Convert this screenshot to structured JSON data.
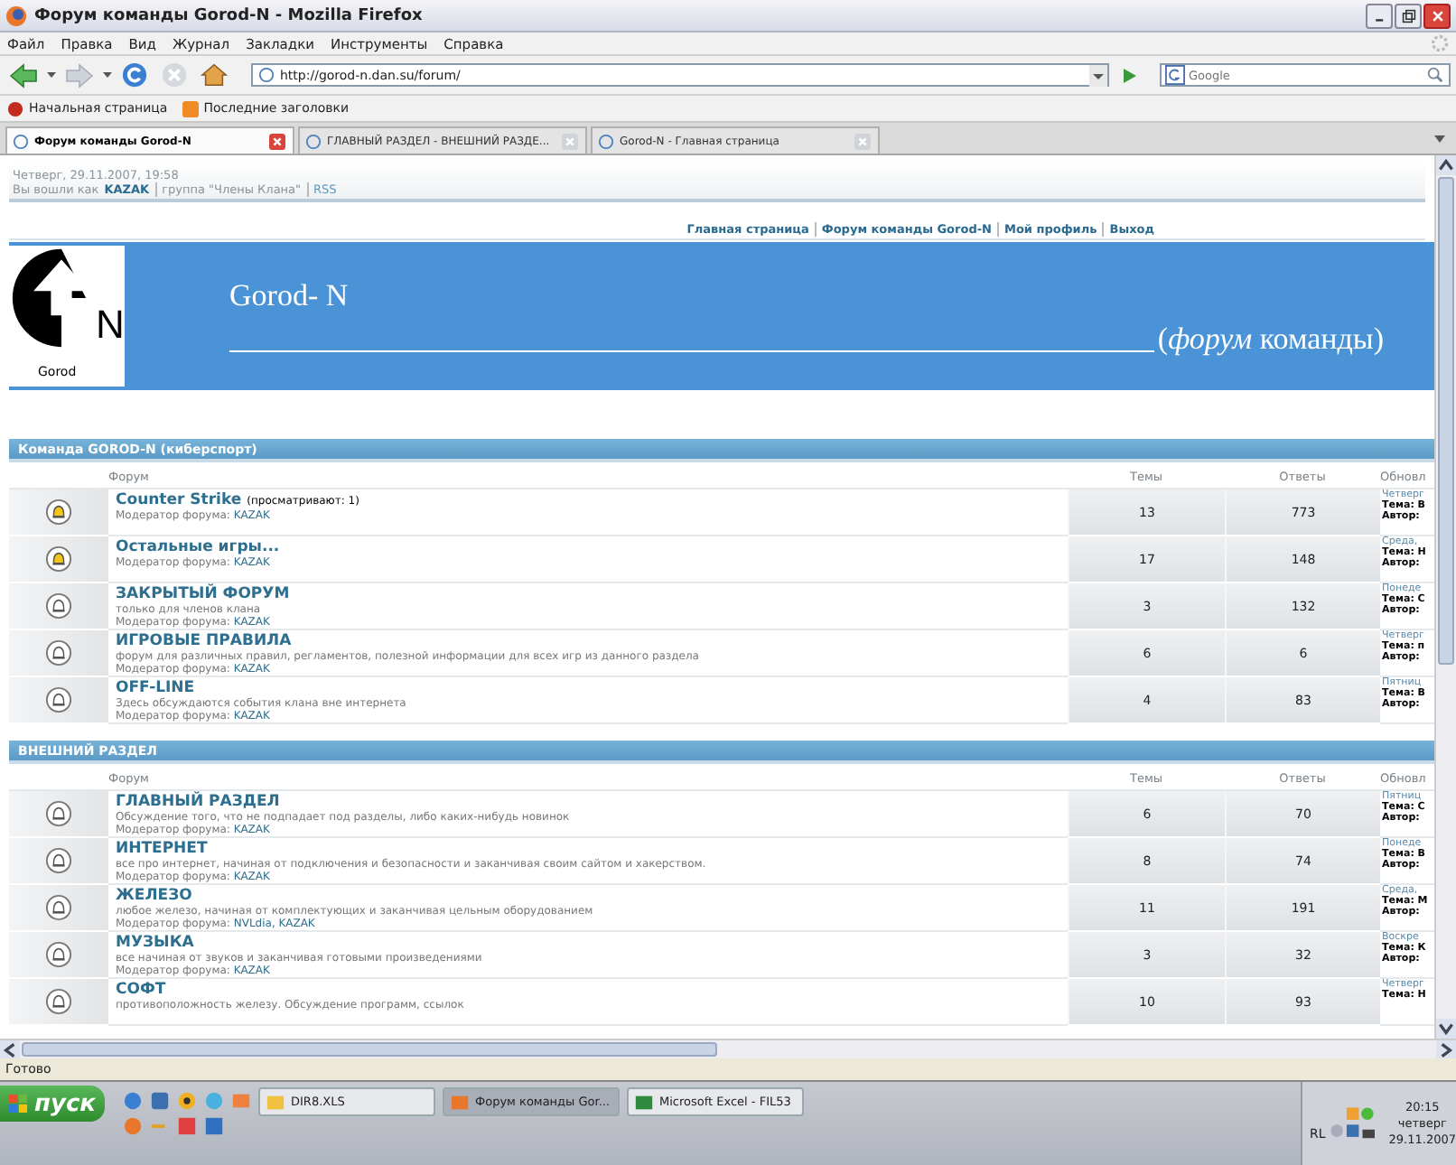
{
  "window": {
    "title": "Форум команды Gorod-N - Mozilla Firefox"
  },
  "menu": [
    "Файл",
    "Правка",
    "Вид",
    "Журнал",
    "Закладки",
    "Инструменты",
    "Справка"
  ],
  "address": {
    "value": "http://gorod-n.dan.su/forum/"
  },
  "search": {
    "placeholder": "Google"
  },
  "bookmarks": [
    "Начальная страница",
    "Последние заголовки"
  ],
  "tabs": [
    {
      "label": "Форум команды Gorod-N",
      "selected": true
    },
    {
      "label": "ГЛАВНЫЙ РАЗДЕЛ - ВНЕШНИЙ РАЗДЕ...",
      "selected": false
    },
    {
      "label": "Gorod-N - Главная страница",
      "selected": false
    }
  ],
  "page": {
    "date": "Четверг, 29.11.2007, 19:58",
    "logged_as": "Вы вошли как",
    "user": "KAZAK",
    "group": "группа \"Члены Клана\"",
    "rss": "RSS",
    "nav_links": [
      "Главная страница",
      "Форум команды Gorod-N",
      "Мой профиль",
      "Выход"
    ],
    "banner": {
      "title": "Gorod- N",
      "subtitle": "(*форум* команды)",
      "logo_letter": "N",
      "logo_caption": "Gorod"
    },
    "sections": [
      {
        "title": "Команда GOROD-N (киберспорт)",
        "columns": [
          "Форум",
          "Темы",
          "Ответы",
          "Обновл"
        ],
        "forums": [
          {
            "name": "Counter Strike",
            "viewing": "(просматривают: 1)",
            "moderator_label": "Модератор форума:",
            "moderators": "KAZAK",
            "topics": "13",
            "replies": "773",
            "last": [
              "Четверг",
              "Тема: В",
              "Автор:"
            ],
            "unread": true
          },
          {
            "name": "Остальные игры...",
            "moderator_label": "Модератор форума:",
            "moderators": "KAZAK",
            "topics": "17",
            "replies": "148",
            "last": [
              "Среда,",
              "Тема: Н",
              "Автор:"
            ],
            "unread": true
          },
          {
            "name": "ЗАКРЫТЫЙ ФОРУМ",
            "description": "только для членов клана",
            "moderator_label": "Модератор форума:",
            "moderators": "KAZAK",
            "topics": "3",
            "replies": "132",
            "last": [
              "Понеде",
              "Тема: С",
              "Автор:"
            ],
            "unread": false
          },
          {
            "name": "ИГРОВЫЕ ПРАВИЛА",
            "description": "форум для различных правил, регламентов, полезной информации для всех игр из данного раздела",
            "moderator_label": "Модератор форума:",
            "moderators": "KAZAK",
            "topics": "6",
            "replies": "6",
            "last": [
              "Четверг",
              "Тема: п",
              "Автор:"
            ],
            "unread": false
          },
          {
            "name": "OFF-LINE",
            "description": "Здесь обсуждаются события клана вне интернета",
            "moderator_label": "Модератор форума:",
            "moderators": "KAZAK",
            "topics": "4",
            "replies": "83",
            "last": [
              "Пятниц",
              "Тема: В",
              "Автор:"
            ],
            "unread": false
          }
        ]
      },
      {
        "title": "ВНЕШНИЙ РАЗДЕЛ",
        "columns": [
          "Форум",
          "Темы",
          "Ответы",
          "Обновл"
        ],
        "forums": [
          {
            "name": "ГЛАВНЫЙ РАЗДЕЛ",
            "description": "Обсуждение того, что не подпадает под разделы, либо каких-нибудь новинок",
            "moderator_label": "Модератор форума:",
            "moderators": "KAZAK",
            "topics": "6",
            "replies": "70",
            "last": [
              "Пятниц",
              "Тема: С",
              "Автор:"
            ],
            "unread": false
          },
          {
            "name": "ИНТЕРНЕТ",
            "description": "все про интернет, начиная от подключения и безопасности и заканчивая своим сайтом и хакерством.",
            "moderator_label": "Модератор форума:",
            "moderators": "KAZAK",
            "topics": "8",
            "replies": "74",
            "last": [
              "Понеде",
              "Тема: В",
              "Автор:"
            ],
            "unread": false
          },
          {
            "name": "ЖЕЛЕЗО",
            "description": "любое железо, начиная от комплектующих и заканчивая цельным оборудованием",
            "moderator_label": "Модератор форума:",
            "moderators": "NVLdia, KAZAK",
            "topics": "11",
            "replies": "191",
            "last": [
              "Среда,",
              "Тема: М",
              "Автор:"
            ],
            "unread": false
          },
          {
            "name": "МУЗЫКА",
            "description": "все начиная от звуков и заканчивая готовыми произведениями",
            "moderator_label": "Модератор форума:",
            "moderators": "KAZAK",
            "topics": "3",
            "replies": "32",
            "last": [
              "Воскре",
              "Тема: К",
              "Автор:"
            ],
            "unread": false
          },
          {
            "name": "СОФТ",
            "description": "противоположность железу. Обсуждение программ, ссылок",
            "topics": "10",
            "replies": "93",
            "last": [
              "Четверг",
              "Тема: Н"
            ],
            "unread": false
          }
        ]
      }
    ]
  },
  "status_bar": "Готово",
  "taskbar": {
    "start": "пуск",
    "tasks": [
      {
        "label": "DIR8.XLS",
        "selected": false
      },
      {
        "label": "Форум команды Gor...",
        "selected": true
      },
      {
        "label": "Microsoft Excel - FIL53",
        "selected": false
      }
    ],
    "tray": "RL",
    "time": "20:15",
    "day": "четверг",
    "date": "29.11.2007"
  }
}
